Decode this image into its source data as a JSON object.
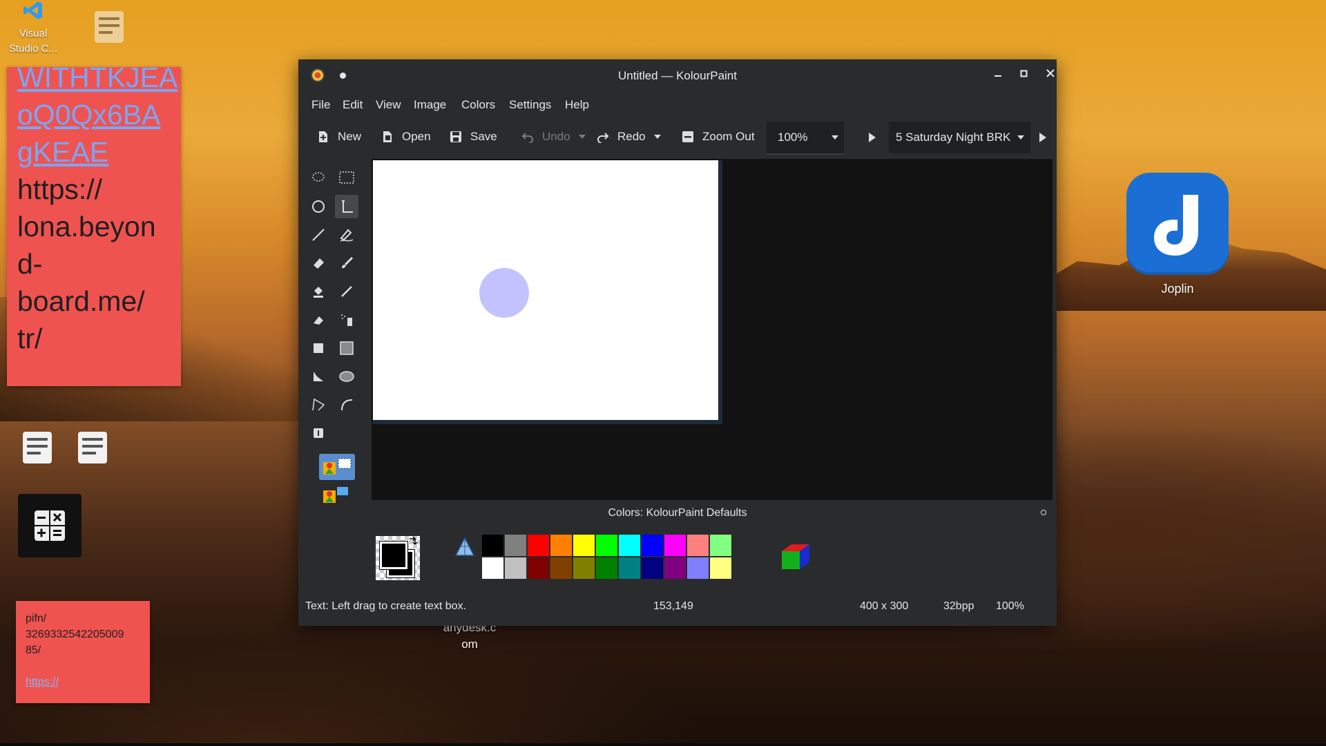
{
  "desktop": {
    "vscode_label": "Visual Studio C...",
    "joplin_label": "Joplin",
    "anydesk_label": "anydesk.c om",
    "sticky_top": {
      "link_lines": [
        "WITHTKJEA",
        "oQ0Qx6BA",
        "gKEAE"
      ],
      "text_lines": [
        "https://",
        "lona.beyon",
        "d-",
        "board.me/",
        "tr/"
      ]
    },
    "sticky_bottom": {
      "text_lines": [
        "pifn/",
        "3269332542205009",
        "85/"
      ],
      "link": "https://"
    }
  },
  "window": {
    "title": "Untitled — KolourPaint",
    "menu": [
      "File",
      "Edit",
      "View",
      "Image",
      "Colors",
      "Settings",
      "Help"
    ],
    "toolbar": {
      "new": "New",
      "open": "Open",
      "save": "Save",
      "undo": "Undo",
      "redo": "Redo",
      "zoom_out": "Zoom Out",
      "zoom_value": "100%",
      "font": "5 Saturday Night BRK"
    },
    "colors_title": "Colors: KolourPaint Defaults",
    "palette_top": [
      "#000000",
      "#808080",
      "#ff0000",
      "#ff8000",
      "#ffff00",
      "#00ff00",
      "#00ffff",
      "#0000ff",
      "#ff00ff",
      "#ff8080",
      "#80ff80"
    ],
    "palette_bottom": [
      "#ffffff",
      "#c0c0c0",
      "#800000",
      "#804000",
      "#808000",
      "#008000",
      "#008080",
      "#000080",
      "#800080",
      "#8080ff",
      "#ffff80"
    ],
    "status": {
      "message": "Text: Left drag to create text box.",
      "cursor": "153,149",
      "size": "400 x 300",
      "depth": "32bpp",
      "zoom": "100%"
    }
  }
}
